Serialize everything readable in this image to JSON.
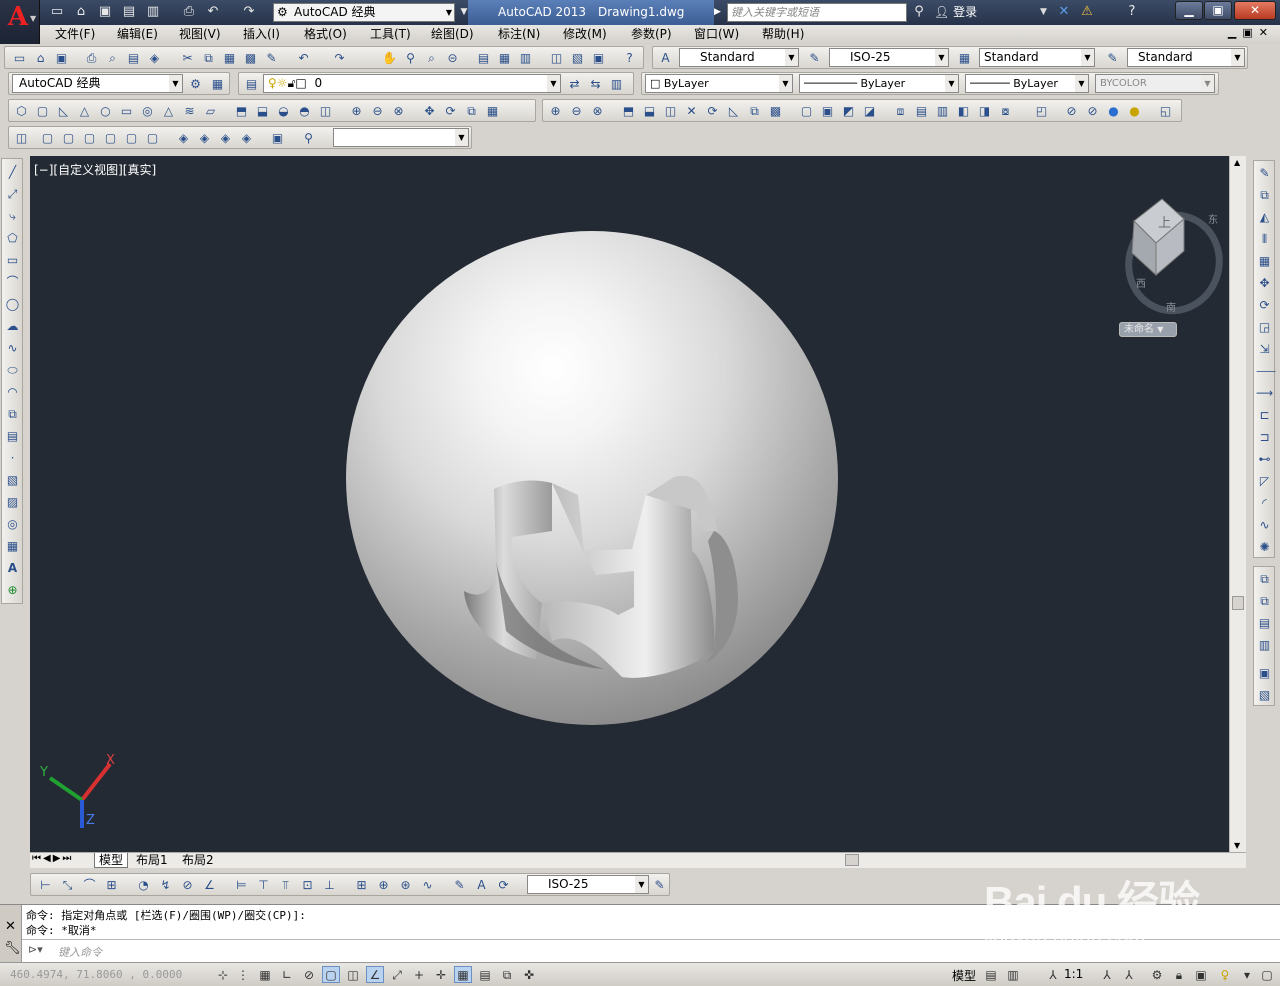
{
  "titlebar": {
    "workspace": "AutoCAD 经典",
    "app_name": "AutoCAD 2013",
    "file_name": "Drawing1.dwg",
    "search_placeholder": "键入关键字或短语",
    "login": "登录"
  },
  "menu": [
    "文件(F)",
    "编辑(E)",
    "视图(V)",
    "插入(I)",
    "格式(O)",
    "工具(T)",
    "绘图(D)",
    "标注(N)",
    "修改(M)",
    "参数(P)",
    "窗口(W)",
    "帮助(H)"
  ],
  "styles_toolbar": {
    "text_style": "Standard",
    "dim_style": "ISO-25",
    "table_style": "Standard",
    "multileader_style": "Standard"
  },
  "layers_toolbar": {
    "workspace": "AutoCAD 经典",
    "current_layer": "0",
    "color": "ByLayer",
    "linetype": "ByLayer",
    "lineweight": "ByLayer",
    "plot_style": "BYCOLOR"
  },
  "viewport": {
    "label": "[−][自定义视图][真实]",
    "viewcube_name": "未命名",
    "viewcube_faces": {
      "top": "上",
      "compass_south": "南",
      "compass_east": "东",
      "compass_west": "西"
    },
    "ucs": {
      "x": "X",
      "y": "Y",
      "z": "Z"
    }
  },
  "tabs": [
    "模型",
    "布局1",
    "布局2"
  ],
  "dim_toolbar": {
    "dim_style": "ISO-25"
  },
  "command": {
    "history": [
      "命令: 指定对角点或 [栏选(F)/圈围(WP)/圈交(CP)]:",
      "命令: *取消*"
    ],
    "input_placeholder": "键入命令"
  },
  "statusbar": {
    "coords": "460.4974, 71.8060 , 0.0000",
    "model": "模型",
    "scale": "1:1"
  },
  "watermark": {
    "brand": "Bai du 经验",
    "url": "jingyan.baidu.com"
  },
  "colors": {
    "viewport_bg": "#232a34",
    "title_active": "#4a6fa8",
    "close_button": "#c8452c",
    "logo_red": "#e22222"
  }
}
